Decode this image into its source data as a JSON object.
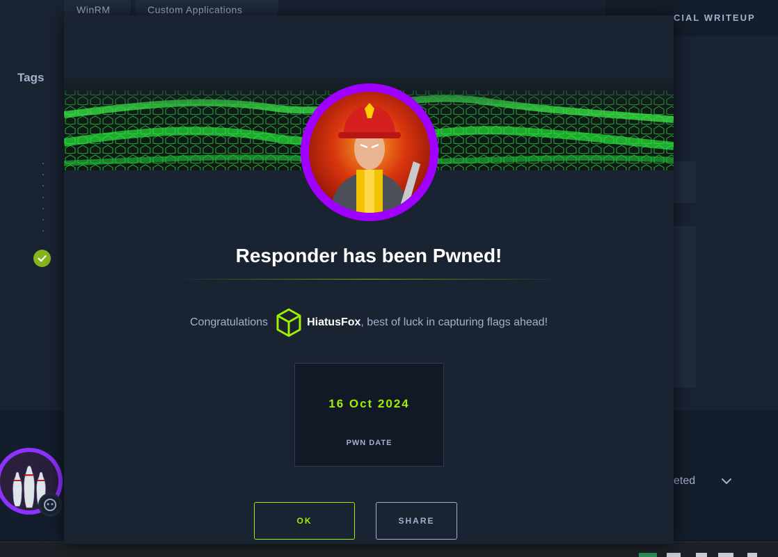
{
  "background": {
    "chips": [
      "WinRM",
      "Custom Applications"
    ],
    "tags_label": "Tags",
    "writeup_label": "CIAL WRITEUP",
    "status_dropdown": "eted"
  },
  "modal": {
    "title": "Responder has been Pwned!",
    "congrats_prefix": "Congratulations",
    "username": "HiatusFox",
    "congrats_suffix": ", best of luck in capturing flags ahead!",
    "pwn_date": "16 Oct 2024",
    "pwn_date_label": "PWN DATE",
    "ok_label": "OK",
    "share_label": "SHARE"
  },
  "colors": {
    "accent_green": "#9fef00",
    "avatar_ring": "#9f00ff",
    "background": "#1a2332"
  },
  "icons": [
    "check-circle-icon",
    "hack-the-box-cube-icon",
    "chevron-down-icon",
    "firefighter-avatar",
    "bowling-pins-avatar"
  ]
}
